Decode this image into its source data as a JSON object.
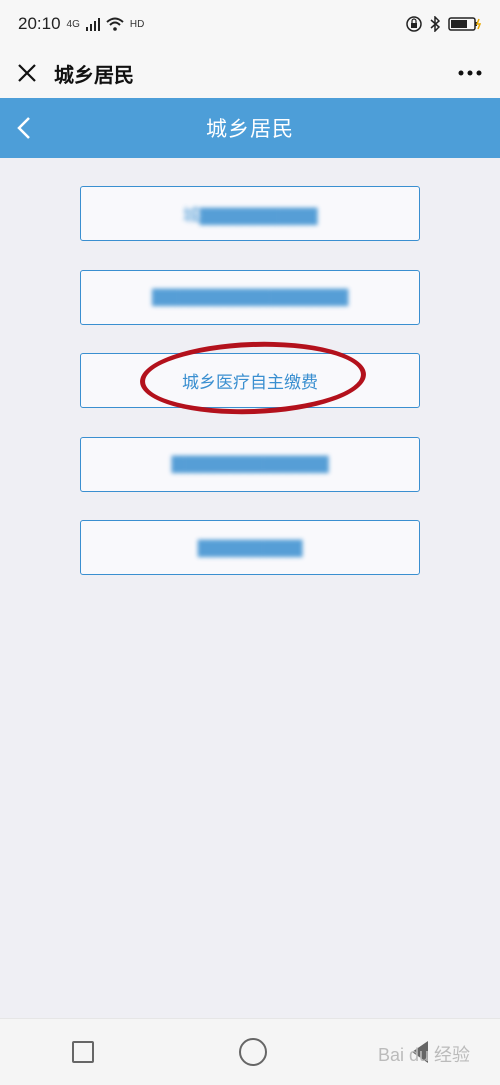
{
  "status_bar": {
    "time": "20:10",
    "signal_label": "4G",
    "hd_label": "HD"
  },
  "app_bar": {
    "title": "城乡居民"
  },
  "page": {
    "title": "城乡居民"
  },
  "menu": [
    {
      "label": "城▇▇▇▇▇▇▇▇▇",
      "obscured": true
    },
    {
      "label": "▇▇▇▇▇▇▇▇▇▇▇▇▇▇▇",
      "obscured": true
    },
    {
      "label": "城乡医疗自主缴费",
      "obscured": false,
      "highlighted": true
    },
    {
      "label": "▇▇▇▇▇▇▇▇▇▇▇▇",
      "obscured": true
    },
    {
      "label": "▇▇▇▇▇▇▇▇",
      "obscured": true
    }
  ],
  "watermark": "Bai du 经验",
  "colors": {
    "accent": "#4d9ed8",
    "button_border": "#3a8fd0",
    "highlight_circle": "#b3111c"
  }
}
